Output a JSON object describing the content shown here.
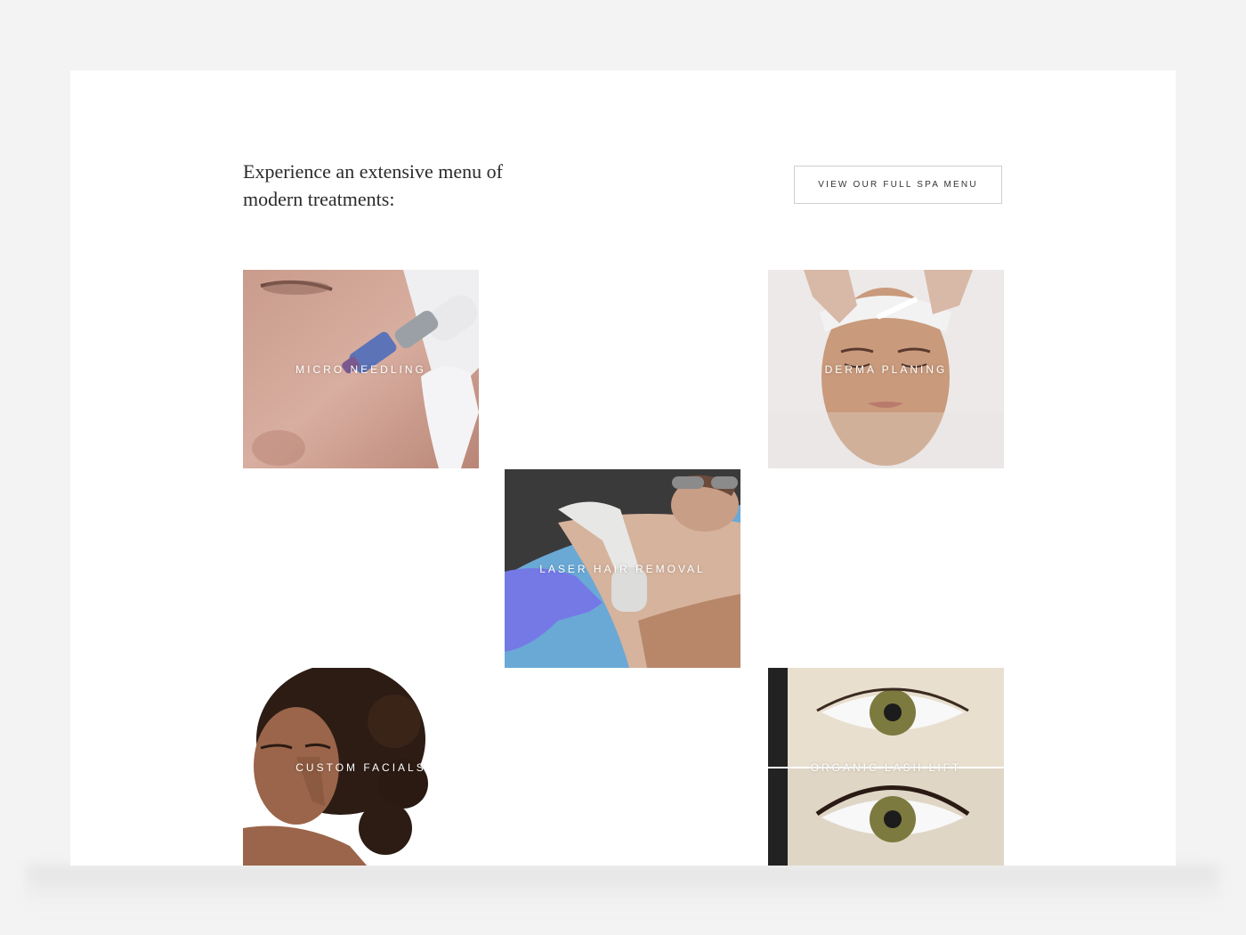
{
  "section": {
    "heading": "Experience an extensive menu of modern treatments:",
    "cta_label": "VIEW OUR FULL SPA MENU"
  },
  "treatments": [
    {
      "label": "MICRO NEEDLING",
      "image": "micro-needling-photo"
    },
    {
      "label": "DERMA PLANING",
      "image": "derma-planing-photo"
    },
    {
      "label": "LASER HAIR REMOVAL",
      "image": "laser-hair-removal-photo"
    },
    {
      "label": "CUSTOM FACIALS",
      "image": "custom-facials-photo"
    },
    {
      "label": "ORGANIC LASH LIFT",
      "image": "organic-lash-lift-photo"
    }
  ],
  "colors": {
    "page_background": "#f3f3f3",
    "card_background": "#ffffff",
    "heading_text": "#2b2b2b",
    "button_border": "#cfcfcf",
    "tile_label": "#ffffff"
  }
}
